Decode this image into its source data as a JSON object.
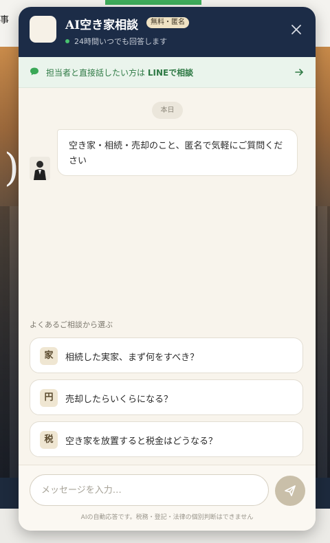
{
  "background": {
    "top_char": "事",
    "big_char": ")"
  },
  "header": {
    "title": "AI空き家相談",
    "badge": "無料・匿名",
    "status": "24時間いつでも回答します",
    "close_icon": "close-icon"
  },
  "line_banner": {
    "text_prefix": "担当者と直接話したい方は ",
    "text_strong": "LINEで相談",
    "icon": "chat-bubble-icon",
    "arrow_icon": "arrow-right-icon"
  },
  "chat": {
    "date_label": "本日",
    "message": "空き家・相続・売却のこと、匿名で気軽にご質問ください"
  },
  "faq": {
    "heading": "よくあるご相談から選ぶ",
    "items": [
      {
        "badge": "家",
        "label": "相続した実家、まず何をすべき？"
      },
      {
        "badge": "円",
        "label": "売却したらいくらになる？"
      },
      {
        "badge": "税",
        "label": "空き家を放置すると税金はどうなる？"
      }
    ]
  },
  "composer": {
    "placeholder": "メッセージを入力…",
    "send_icon": "send-icon",
    "disclaimer": "AIの自動応答です。税務・登記・法律の個別判断はできません"
  },
  "colors": {
    "header_bg": "#1c2c47",
    "panel_bg": "#f8f4ec",
    "line_green": "#2f7a45",
    "status_green": "#48c26f",
    "send_button": "#c9bfa9"
  }
}
